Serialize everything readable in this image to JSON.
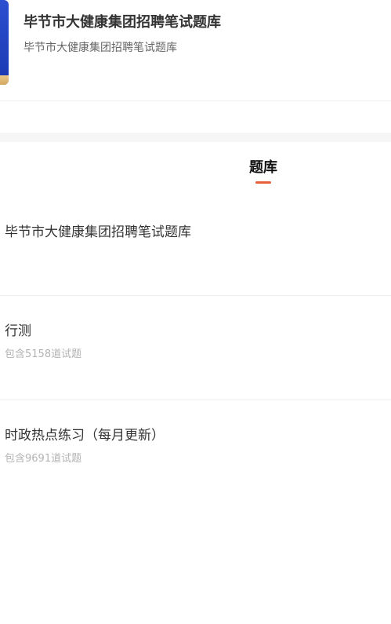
{
  "header": {
    "title": "毕节市大健康集团招聘笔试题库",
    "subtitle": "毕节市大健康集团招聘笔试题库"
  },
  "tabs": [
    {
      "label": "题库",
      "active": true
    }
  ],
  "bank": {
    "title": "毕节市大健康集团招聘笔试题库",
    "items": [
      {
        "name": "行测",
        "count_text": "包含5158道试题"
      },
      {
        "name": "时政热点练习（每月更新）",
        "count_text": "包含9691道试题"
      }
    ]
  },
  "colors": {
    "accent": "#e8603a",
    "cover": "#2c4fd0"
  }
}
